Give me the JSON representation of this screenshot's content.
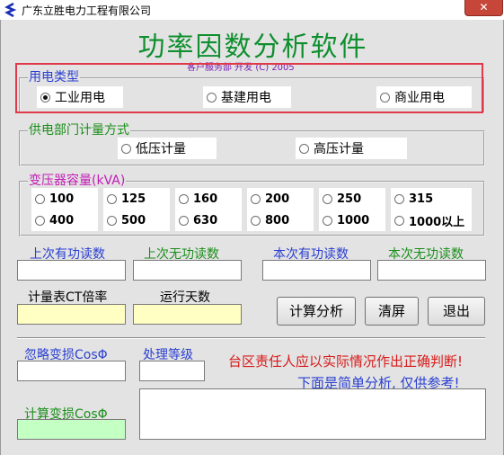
{
  "window": {
    "title": "广东立胜电力工程有限公司",
    "close_label": "✕"
  },
  "header": {
    "app_title": "功率因数分析软件",
    "credit": "客户服务部 开发 (C) 2005"
  },
  "usage_type": {
    "label": "用电类型",
    "options": [
      "工业用电",
      "基建用电",
      "商业用电"
    ],
    "selected": "工业用电"
  },
  "metering": {
    "label": "供电部门计量方式",
    "options": [
      "低压计量",
      "高压计量"
    ]
  },
  "transformer": {
    "label": "变压器容量(kVA)",
    "options": [
      "100",
      "125",
      "160",
      "200",
      "250",
      "315",
      "400",
      "500",
      "630",
      "800",
      "1000",
      "1000以上"
    ]
  },
  "readings": {
    "last_active": "上次有功读数",
    "last_reactive": "上次无功读数",
    "curr_active": "本次有功读数",
    "curr_reactive": "本次无功读数",
    "ct_ratio": "计量表CT倍率",
    "run_days": "运行天数"
  },
  "buttons": {
    "calculate": "计算分析",
    "clear": "清屏",
    "exit": "退出"
  },
  "loss": {
    "ignore_label": "忽略变损CosΦ",
    "grade_label": "处理等级",
    "calc_label": "计算变损CosΦ"
  },
  "notes": {
    "warning": "台区责任人应以实际情况作出正确判断!",
    "hint": "下面是简单分析, 仅供参考!"
  },
  "colors": {
    "title_green": "#0f8f2f",
    "label_blue": "#2a3fd1",
    "label_green": "#1a8f1a",
    "label_magenta": "#c41ab5",
    "warning_red": "#d81a1a"
  }
}
